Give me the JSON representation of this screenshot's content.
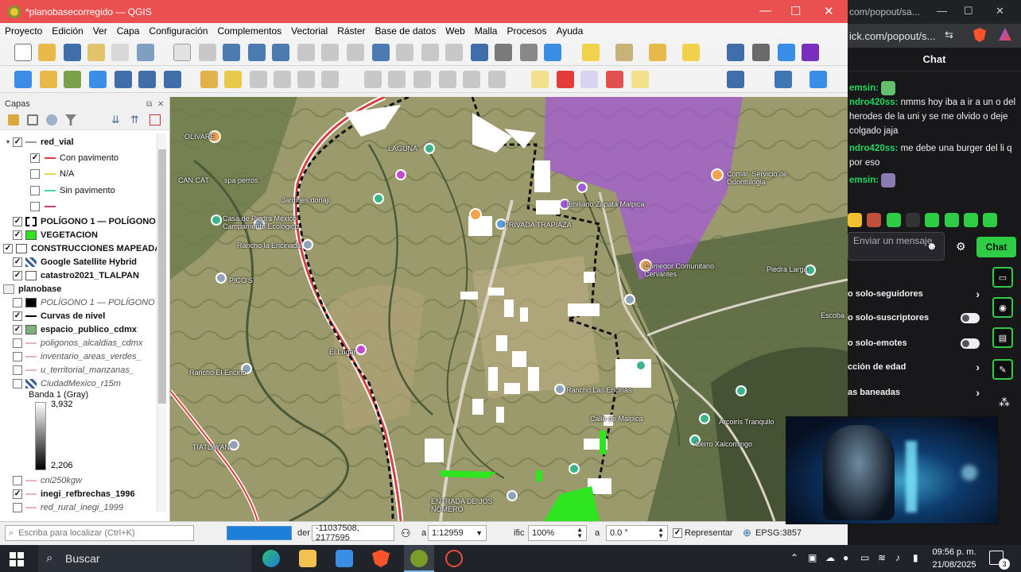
{
  "qgis": {
    "title": "*planobasecorregido — QGIS",
    "menu": [
      "Proyecto",
      "Edición",
      "Ver",
      "Capa",
      "Configuración",
      "Complementos",
      "Vectorial",
      "Ráster",
      "Base de datos",
      "Web",
      "Malla",
      "Procesos",
      "Ayuda"
    ]
  },
  "layers_panel": {
    "title": "Capas",
    "items": [
      {
        "label": "red_vial",
        "checked": true,
        "style": "bold",
        "expanded": true
      },
      {
        "label": "Con pavimento",
        "checked": true,
        "style": "normal",
        "color": "#e23c3c"
      },
      {
        "label": "N/A",
        "checked": false,
        "style": "normal",
        "color": "#e6d84a"
      },
      {
        "label": "Sin pavimento",
        "checked": false,
        "style": "normal",
        "color": "#4ad9b0"
      },
      {
        "label": "",
        "checked": false,
        "style": "normal",
        "color": "#c43d6b"
      },
      {
        "label": "POLÍGONO 1 — POLÍGONO",
        "checked": true,
        "style": "bold"
      },
      {
        "label": "VEGETACION",
        "checked": true,
        "style": "bold"
      },
      {
        "label": "CONSTRUCCIONES MAPEADAS",
        "checked": true,
        "style": "bold"
      },
      {
        "label": "Google Satellite Hybrid",
        "checked": true,
        "style": "bold"
      },
      {
        "label": "catastro2021_TLALPAN",
        "checked": true,
        "style": "bold"
      },
      {
        "label": "planobase",
        "checked": null,
        "style": "bold"
      },
      {
        "label": "POLÍGONO 1 — POLÍGONO",
        "checked": false,
        "style": "italic"
      },
      {
        "label": "Curvas de nivel",
        "checked": true,
        "style": "bold"
      },
      {
        "label": "espacio_publico_cdmx",
        "checked": true,
        "style": "bold"
      },
      {
        "label": "poligonos_alcaldias_cdmx",
        "checked": false,
        "style": "italic"
      },
      {
        "label": "inventario_areas_verdes_",
        "checked": false,
        "style": "italic"
      },
      {
        "label": "u_territorial_manzanas_",
        "checked": false,
        "style": "italic"
      },
      {
        "label": "CiudadMexico_r15m",
        "checked": false,
        "style": "italic"
      },
      {
        "label": "Banda 1 (Gray)",
        "checked": null,
        "style": "normal"
      },
      {
        "label": "cni250kgw",
        "checked": false,
        "style": "italic"
      },
      {
        "label": "inegi_refbrechas_1996",
        "checked": true,
        "style": "bold"
      },
      {
        "label": "red_rural_inegi_1999",
        "checked": false,
        "style": "italic"
      }
    ],
    "raster_max": "3,932",
    "raster_min": "2,206"
  },
  "map_labels": [
    "OLIVARE",
    "CAN CAT",
    "spa perros",
    "LAGUNA",
    "Jardines donaji",
    "Casa de Piedra México Campamento Ecológico",
    "Rancho la Encinada",
    "PICO'S",
    "El Lugar",
    "Rancho El Encino",
    "PRIVADA TRAPIAZA",
    "Emiliano Zapata Malpica",
    "Comedor Comunitario Cervantes",
    "Comar. Servicio de Odontología",
    "Piedra Larga",
    "Escoba",
    "Cerro Xalcomingo",
    "Arcoiris Tranquilo",
    "TIATLAYAN",
    "ENTRADA DE JOS NOMERO",
    "Rancho Las Encinas",
    "Calle de Malpica"
  ],
  "status": {
    "search_placeholder": "Escriba para localizar (Ctrl+K)",
    "coord_label": "der",
    "coordinate": "-11037508, 2177595",
    "scale_label": "a",
    "scale": "1:12959",
    "magnifier_label": "ific",
    "magnifier": "100%",
    "rotation_label": "a",
    "rotation": "0.0 °",
    "render_label": "Representar",
    "crs": "EPSG:3857"
  },
  "browser": {
    "tab_text": "com/popout/sa...",
    "url": "ick.com/popout/s...",
    "chat_title": "Chat",
    "messages": [
      {
        "user": "emsin:",
        "text": ""
      },
      {
        "user": "ndro420ss:",
        "text": "nmms hoy iba a ir a un o del herodes de la uni y se me olvido o deje colgado jaja"
      },
      {
        "user": "ndro420ss:",
        "text": "me debe una burger del li q por eso"
      },
      {
        "user": "emsin:",
        "text": ""
      }
    ],
    "input_placeholder": "Enviar un mensaje",
    "send_button": "Chat",
    "settings": [
      {
        "label": "o solo-seguidores",
        "control": "chevron"
      },
      {
        "label": "o solo-suscriptores",
        "control": "toggle"
      },
      {
        "label": "o solo-emotes",
        "control": "toggle"
      },
      {
        "label": "cción de edad",
        "control": "chevron"
      },
      {
        "label": "as baneadas",
        "control": "chevron"
      }
    ]
  },
  "taskbar": {
    "search": "Buscar",
    "time": "09:56 p. m.",
    "date": "21/08/2025",
    "notifications": "3"
  }
}
